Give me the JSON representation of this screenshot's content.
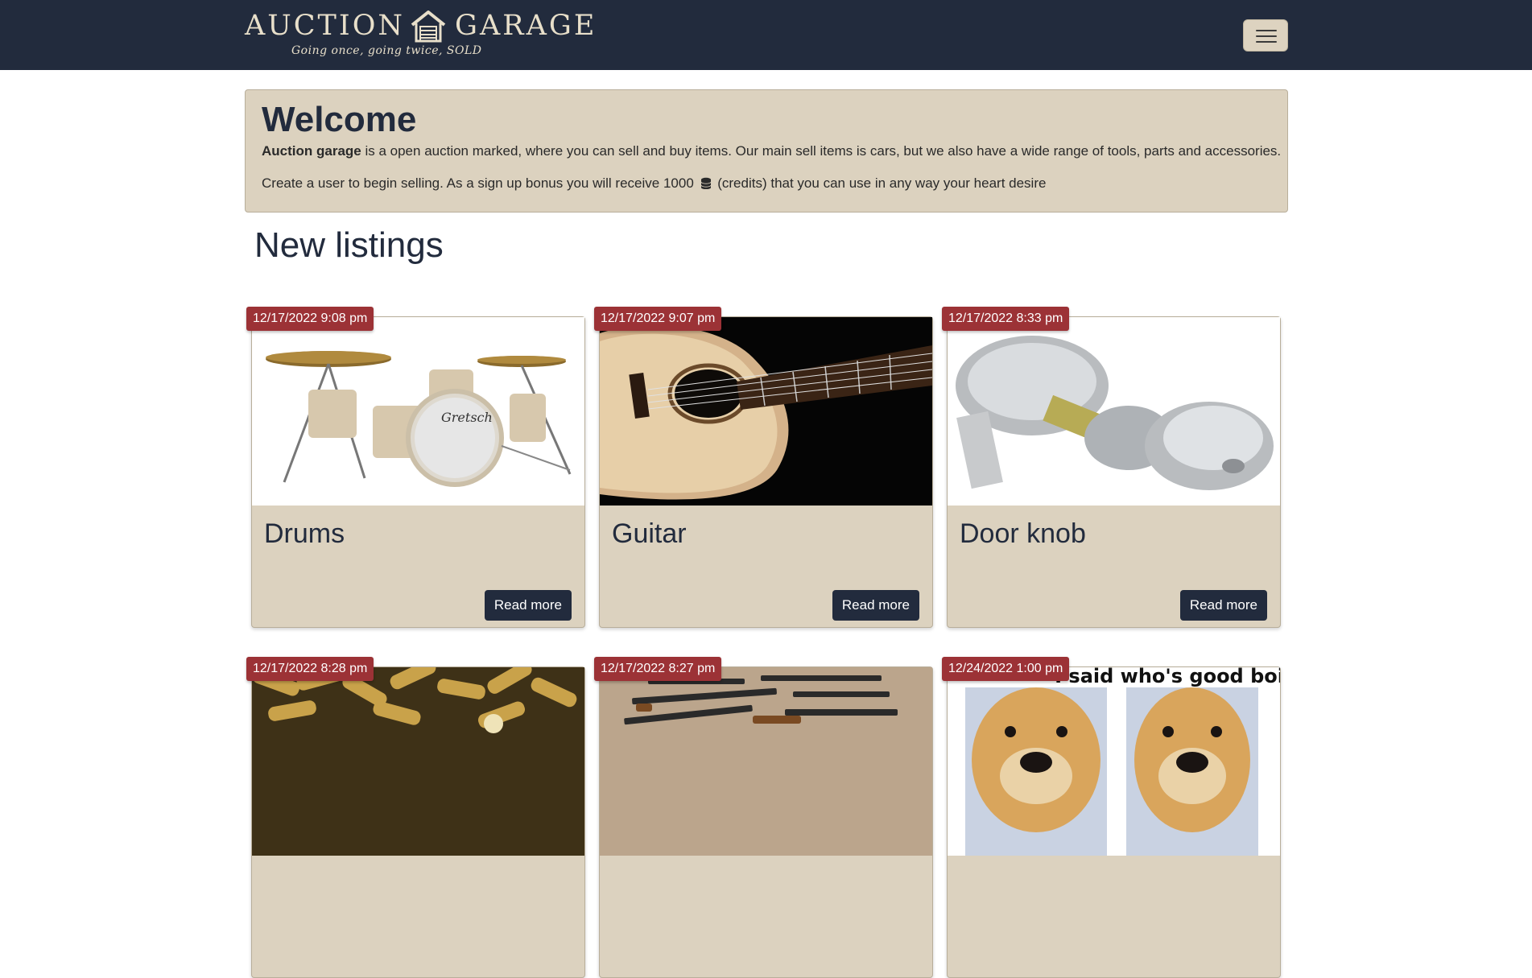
{
  "header": {
    "brand_left": "AUCTION",
    "brand_right": "GARAGE",
    "tagline": "Going once, going twice, SOLD",
    "menu_toggle_icon": "hamburger-icon"
  },
  "welcome": {
    "title": "Welcome",
    "p1_bold": "Auction garage",
    "p1_rest": " is a open auction marked, where you can sell and buy items. Our main sell items is cars, but we also have a wide range of tools, parts and accessories.",
    "p2_before": "Create a user to begin selling. As a sign up bonus you will receive 1000",
    "p2_icon": "coins-icon",
    "p2_after": " (credits) that you can use in any way your heart desire"
  },
  "listings": {
    "title": "New listings",
    "read_more": "Read more",
    "items": [
      {
        "date": "12/17/2022 9:08 pm",
        "title": "Drums",
        "image": "drum-kit"
      },
      {
        "date": "12/17/2022 9:07 pm",
        "title": "Guitar",
        "image": "acoustic-guitar"
      },
      {
        "date": "12/17/2022 8:33 pm",
        "title": "Door knob",
        "image": "door-knob"
      },
      {
        "date": "12/17/2022 8:28 pm",
        "title": "",
        "image": "ammunition"
      },
      {
        "date": "12/17/2022 8:27 pm",
        "title": "",
        "image": "rifles"
      },
      {
        "date": "12/24/2022 1:00 pm",
        "title": "",
        "image": "dog-meme",
        "image_text": "I said who's good boi"
      }
    ]
  },
  "colors": {
    "navbar": "#222b3d",
    "panel": "#dcd2bf",
    "badge": "#9c3236",
    "button": "#222b3d"
  }
}
